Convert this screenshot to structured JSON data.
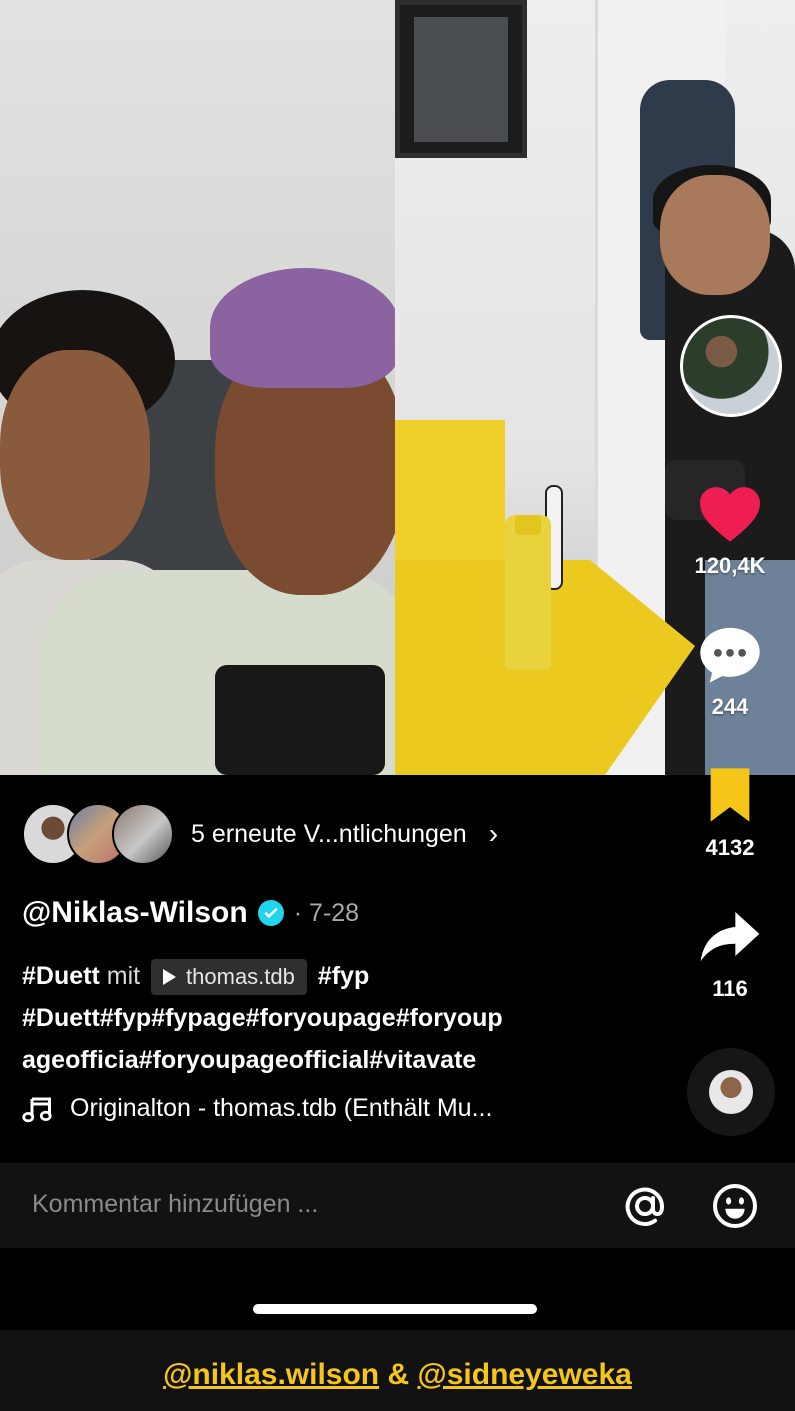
{
  "video": {
    "stats": {
      "likes": "120,4K",
      "comments": "244",
      "saves": "4132",
      "shares": "116"
    }
  },
  "reposts": {
    "label": "5 erneute V...ntlichungen",
    "chevron": "›"
  },
  "post": {
    "author": "@Niklas-Wilson",
    "date": "· 7-28",
    "caption": {
      "duet_tag": "#Duett",
      "mit": "mit",
      "duet_user": "thomas.tdb",
      "tag_after": "#fyp",
      "line2": "#Duett#fyp#fypage#foryoupage#foryoup",
      "line3": "ageofficia#foryoupageofficial#vitavate"
    },
    "sound": "Originalton - thomas.tdb (Enthält Mu..."
  },
  "comment_bar": {
    "placeholder": "Kommentar hinzufügen ..."
  },
  "credits": {
    "user1": "@niklas.wilson",
    "amp": "&",
    "user2": "@sidneyeweka"
  },
  "colors": {
    "like": "#ee1d52",
    "save": "#f5c518",
    "verified": "#20d5ec",
    "credits": "#f5c518"
  },
  "icons": [
    "heart-icon",
    "comment-icon",
    "bookmark-icon",
    "share-icon",
    "music-note-icon",
    "at-icon",
    "emoji-icon",
    "verified-badge-icon",
    "chevron-right-icon"
  ]
}
